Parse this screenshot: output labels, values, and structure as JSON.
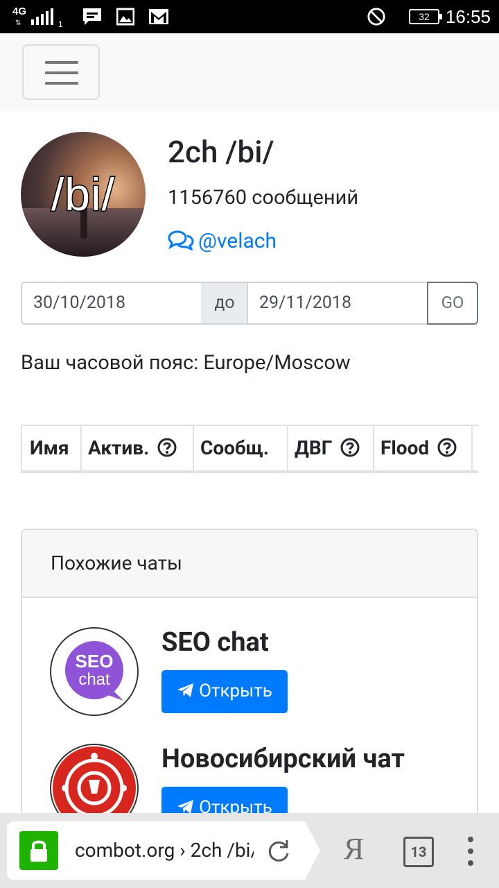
{
  "status_bar": {
    "network": "4G",
    "sim": "1",
    "battery": "32",
    "time": "16:55",
    "icons": [
      "signal-icon",
      "message-icon",
      "gallery-icon",
      "gmail-icon",
      "do-not-disturb-icon",
      "battery-icon"
    ]
  },
  "navbar": {
    "menu_icon": "hamburger-icon"
  },
  "chat": {
    "avatar_text": "/bi/",
    "title": "2ch /bi/",
    "messages": "1156760 сообщений",
    "handle": "@velach",
    "handle_icon": "comments-icon"
  },
  "range": {
    "from": "30/10/2018",
    "separator": "до",
    "to": "29/11/2018",
    "go_label": "GO"
  },
  "timezone": "Ваш часовой пояс: Europe/Moscow",
  "table": {
    "headers": [
      "Имя",
      "Актив.",
      "Сообщ.",
      "ДВГ",
      "Flood"
    ],
    "help_icon": "question-circle-icon"
  },
  "similar": {
    "header": "Похожие чаты",
    "items": [
      {
        "name": "SEO chat",
        "logo_line1": "SEO",
        "logo_line2": "chat",
        "button": "Открыть"
      },
      {
        "name": "Новосибирский чат",
        "button": "Открыть"
      }
    ],
    "button_icon": "telegram-plane-icon"
  },
  "browser": {
    "url": "combot.org › 2ch /bi/",
    "tabs_count": "13",
    "ya_label": "Я",
    "colors": {
      "lock": "#1db300",
      "primary": "#007bff"
    }
  }
}
